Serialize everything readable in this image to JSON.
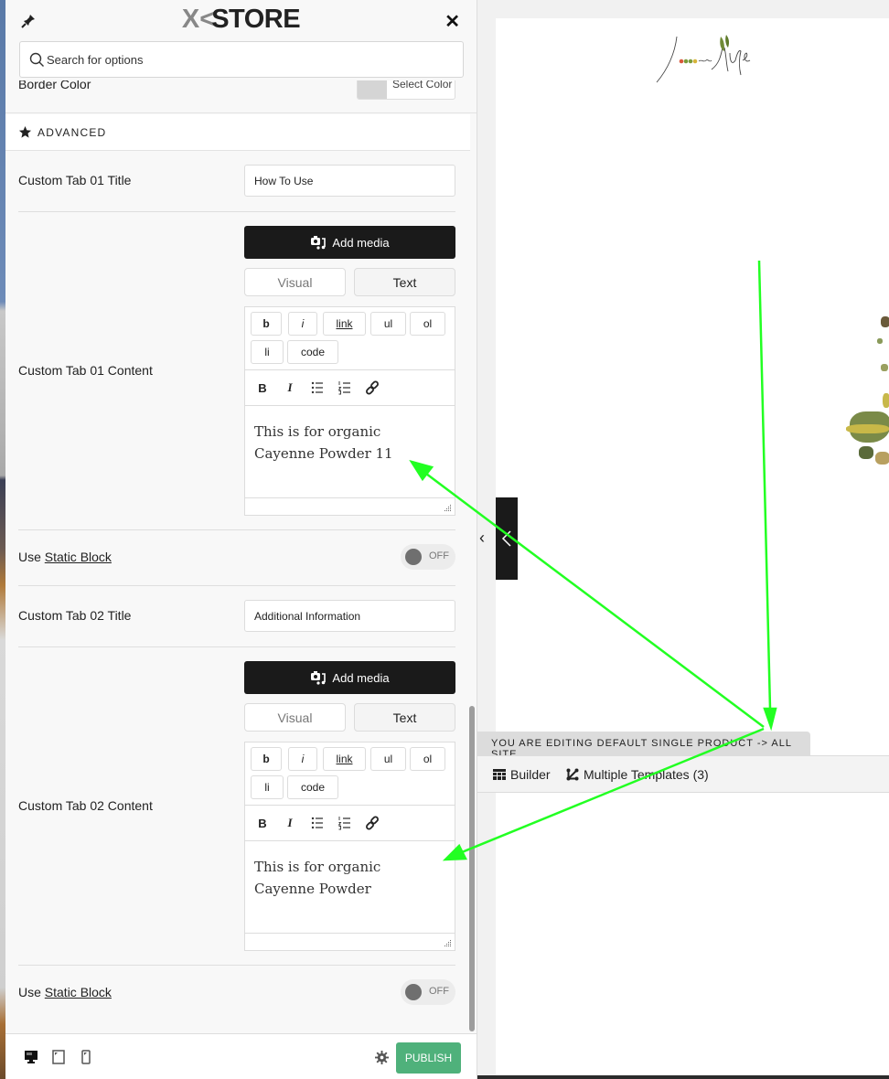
{
  "panel": {
    "brand": "STORE",
    "brand_prefix": "X",
    "search_placeholder": "Search for options",
    "border_color_label": "Border Color",
    "select_color_label": "Select Color",
    "section_title": "ADVANCED",
    "tab1": {
      "title_label": "Custom Tab 01 Title",
      "title_value": "How To Use",
      "content_label": "Custom Tab 01 Content",
      "content_text": "This is for organic Cayenne Powder 11",
      "static_block_prefix": "Use ",
      "static_block_link": "Static Block",
      "toggle_state": "OFF"
    },
    "tab2": {
      "title_label": "Custom Tab 02 Title",
      "title_value": "Additional Information",
      "content_label": "Custom Tab 02 Content",
      "content_text": "This is for organic Cayenne Powder",
      "static_block_prefix": "Use ",
      "static_block_link": "Static Block",
      "toggle_state": "OFF"
    },
    "editor": {
      "add_media_label": "Add media",
      "visual_tab": "Visual",
      "text_tab": "Text",
      "active_tab": "Text",
      "quicktags": [
        "b",
        "i",
        "link",
        "ul",
        "ol",
        "li",
        "code"
      ],
      "format_icons": [
        "bold-icon",
        "italic-icon",
        "bullet-list-icon",
        "numbered-list-icon",
        "link-icon"
      ]
    },
    "footer": {
      "devices": [
        "desktop-icon",
        "tablet-icon",
        "mobile-icon"
      ],
      "publish_label": "PUBLISH"
    }
  },
  "preview": {
    "logo_text": "Love Life",
    "editing_notice": "YOU ARE EDITING DEFAULT SINGLE PRODUCT -> ALL SITE",
    "builder_label": "Builder",
    "templates_label": "Multiple Templates (3)"
  },
  "colors": {
    "publish": "#4fb17b",
    "annotation_arrow": "#22ff22",
    "dark_button": "#1a1a1a"
  }
}
